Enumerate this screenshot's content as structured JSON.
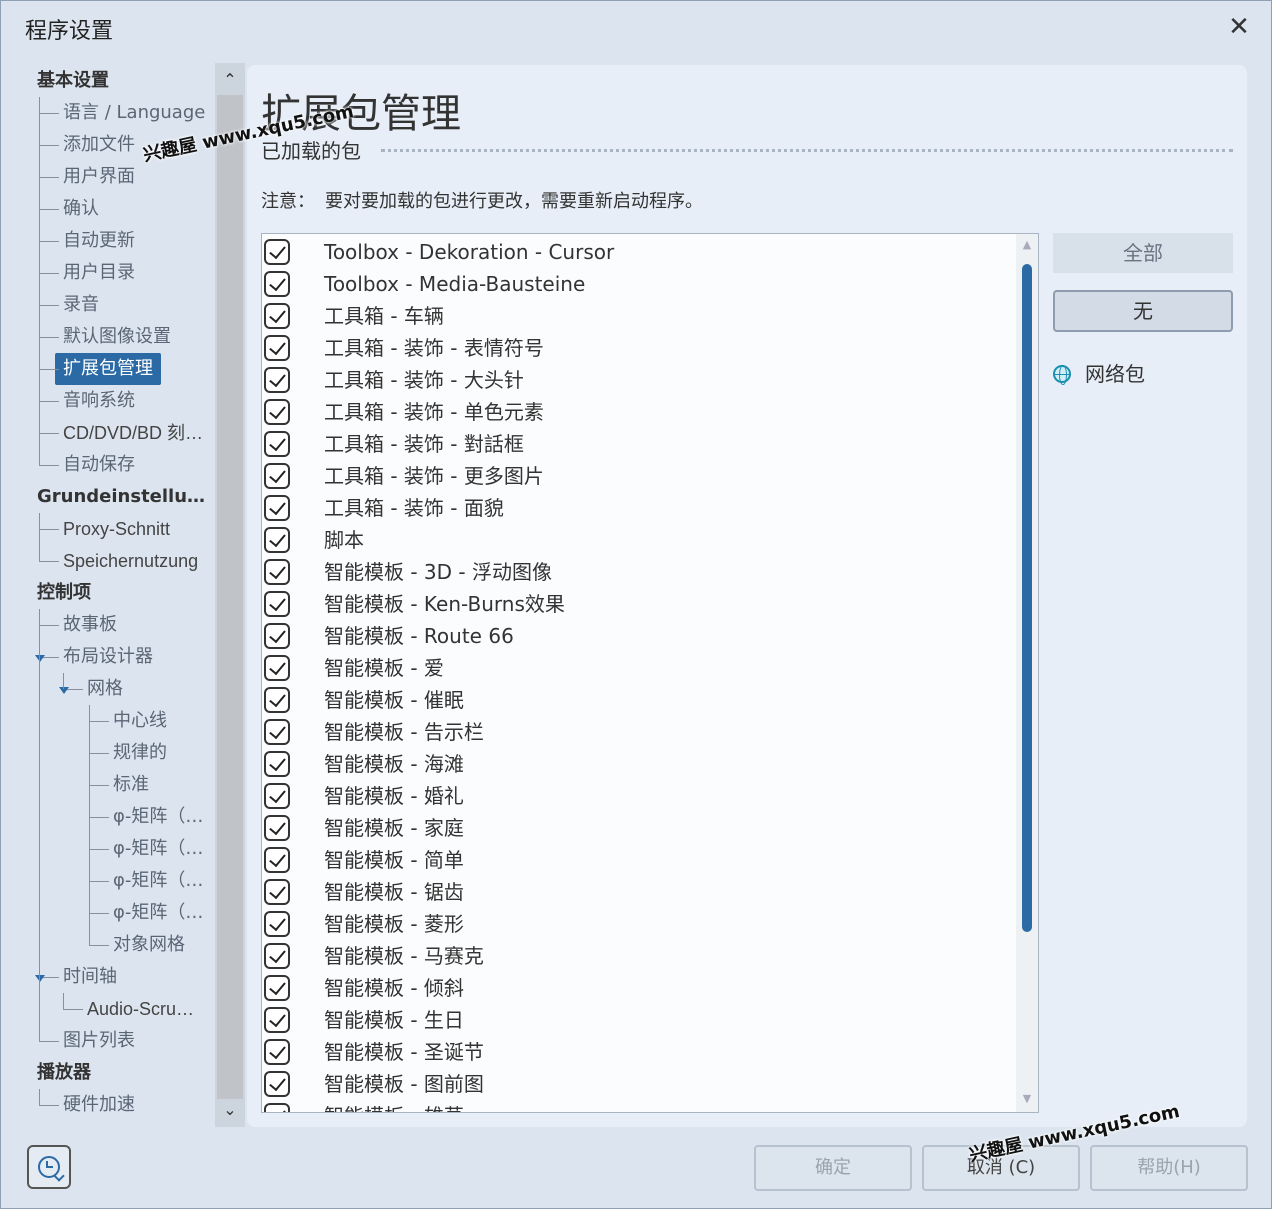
{
  "window": {
    "title": "程序设置",
    "close_glyph": "✕"
  },
  "sidebar": {
    "items": [
      {
        "label": "基本设置",
        "level": 0,
        "header": true
      },
      {
        "label": "语言 / Language",
        "level": 1
      },
      {
        "label": "添加文件",
        "level": 1
      },
      {
        "label": "用户界面",
        "level": 1
      },
      {
        "label": "确认",
        "level": 1
      },
      {
        "label": "自动更新",
        "level": 1
      },
      {
        "label": "用户目录",
        "level": 1
      },
      {
        "label": "录音",
        "level": 1
      },
      {
        "label": "默认图像设置",
        "level": 1
      },
      {
        "label": "扩展包管理",
        "level": 1,
        "selected": true
      },
      {
        "label": "音响系统",
        "level": 1
      },
      {
        "label": "CD/DVD/BD 刻…",
        "level": 1
      },
      {
        "label": "自动保存",
        "level": 1
      },
      {
        "label": "Grundeinstellungen",
        "level": 0,
        "header": true
      },
      {
        "label": "Proxy-Schnitt",
        "level": 1
      },
      {
        "label": "Speichernutzung",
        "level": 1
      },
      {
        "label": "控制项",
        "level": 0,
        "header": true
      },
      {
        "label": "故事板",
        "level": 1
      },
      {
        "label": "布局设计器",
        "level": 1,
        "expanded": true
      },
      {
        "label": "网格",
        "level": 2,
        "expanded": true
      },
      {
        "label": "中心线",
        "level": 3
      },
      {
        "label": "规律的",
        "level": 3
      },
      {
        "label": "标准",
        "level": 3
      },
      {
        "label": "φ-矩阵（…",
        "level": 3
      },
      {
        "label": "φ-矩阵（…",
        "level": 3
      },
      {
        "label": "φ-矩阵（…",
        "level": 3
      },
      {
        "label": "φ-矩阵（…",
        "level": 3
      },
      {
        "label": "对象网格",
        "level": 3
      },
      {
        "label": "时间轴",
        "level": 1,
        "expanded": true
      },
      {
        "label": "Audio-Scru…",
        "level": 2
      },
      {
        "label": "图片列表",
        "level": 1
      },
      {
        "label": "播放器",
        "level": 0,
        "header": true
      },
      {
        "label": "硬件加速",
        "level": 1
      }
    ],
    "scroll_up_glyph": "⌃",
    "scroll_down_glyph": "⌄"
  },
  "main": {
    "page_title": "扩展包管理",
    "section_title": "已加载的包",
    "note_label": "注意：",
    "note_text": "要对要加载的包进行更改，需要重新启动程序。",
    "packages": [
      {
        "label": "Toolbox - Dekoration - Cursor",
        "checked": true
      },
      {
        "label": "Toolbox - Media-Bausteine",
        "checked": true
      },
      {
        "label": "工具箱 - 车辆",
        "checked": true
      },
      {
        "label": "工具箱 - 装饰 - 表情符号",
        "checked": true
      },
      {
        "label": "工具箱 - 装饰 - 大头针",
        "checked": true
      },
      {
        "label": "工具箱 - 装饰 - 单色元素",
        "checked": true
      },
      {
        "label": "工具箱 - 装饰 - 對話框",
        "checked": true
      },
      {
        "label": "工具箱 - 装饰 - 更多图片",
        "checked": true
      },
      {
        "label": "工具箱 - 装饰 - 面貌",
        "checked": true
      },
      {
        "label": "脚本",
        "checked": true
      },
      {
        "label": "智能模板 - 3D - 浮动图像",
        "checked": true
      },
      {
        "label": "智能模板 - Ken-Burns效果",
        "checked": true
      },
      {
        "label": "智能模板 - Route 66",
        "checked": true
      },
      {
        "label": "智能模板 - 爱",
        "checked": true
      },
      {
        "label": "智能模板 - 催眠",
        "checked": true
      },
      {
        "label": "智能模板 - 告示栏",
        "checked": true
      },
      {
        "label": "智能模板 - 海滩",
        "checked": true
      },
      {
        "label": "智能模板 - 婚礼",
        "checked": true
      },
      {
        "label": "智能模板 - 家庭",
        "checked": true
      },
      {
        "label": "智能模板 - 简单",
        "checked": true
      },
      {
        "label": "智能模板 - 锯齿",
        "checked": true
      },
      {
        "label": "智能模板 - 菱形",
        "checked": true
      },
      {
        "label": "智能模板 - 马赛克",
        "checked": true
      },
      {
        "label": "智能模板 - 倾斜",
        "checked": true
      },
      {
        "label": "智能模板 - 生日",
        "checked": true
      },
      {
        "label": "智能模板 - 圣诞节",
        "checked": true
      },
      {
        "label": "智能模板 - 图前图",
        "checked": true
      },
      {
        "label": "智能模板 - 雄草",
        "checked": true
      }
    ],
    "btn_all": "全部",
    "btn_none": "无",
    "net_pack": "网络包"
  },
  "footer": {
    "ok": "确定",
    "cancel": "取消 (C)",
    "help": "帮助(H)"
  },
  "watermarks": {
    "top": "兴趣屋 www.xqu5.com",
    "bottom": "兴趣屋 www.xqu5.com"
  }
}
